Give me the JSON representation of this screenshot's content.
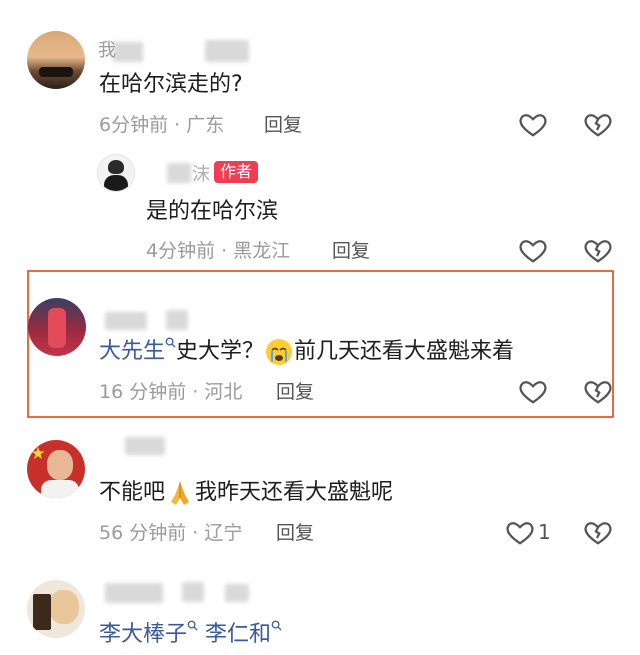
{
  "comments": [
    {
      "name": "comment-1",
      "username_visible": "我",
      "text": "在哈尔滨走的?",
      "time": "6分钟前",
      "location": "广东",
      "reply_label": "回复"
    },
    {
      "name": "reply-1",
      "username_visible": "沫",
      "author_badge": "作者",
      "text": "是的在哈尔滨",
      "time": "4分钟前",
      "location": "黑龙江",
      "reply_label": "回复"
    },
    {
      "name": "comment-2",
      "mention": "大先生",
      "text": "史大学？",
      "text_after_emoji": "前几天还看大盛魁来着",
      "time": "16 分钟前",
      "location": "河北",
      "reply_label": "回复"
    },
    {
      "name": "comment-3",
      "text_before_emoji": "不能吧",
      "text_after_emoji": "我昨天还看大盛魁呢",
      "time": "56 分钟前",
      "location": "辽宁",
      "reply_label": "回复",
      "like_count": "1"
    },
    {
      "name": "comment-4",
      "mentions": [
        "李大棒子",
        "李仁和"
      ]
    }
  ],
  "separator": " · ",
  "colors": {
    "highlight_border": "#e76b3b",
    "author_badge": "#f13d54",
    "mention": "#3a5a9c",
    "meta": "#9b9b9b"
  },
  "icons": [
    "heart-outline-icon",
    "broken-heart-icon",
    "search-icon",
    "crying-face-emoji",
    "praying-hands-emoji"
  ]
}
